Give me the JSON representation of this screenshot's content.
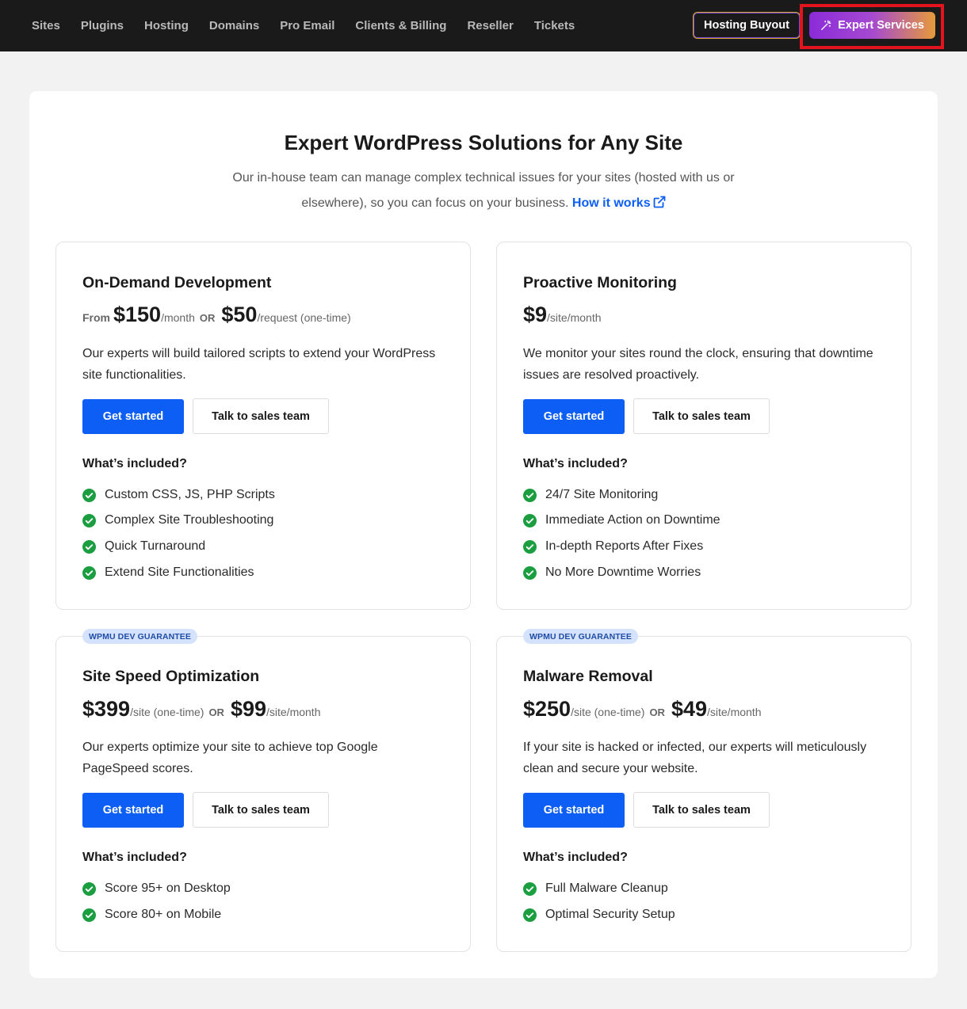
{
  "nav": {
    "items": [
      {
        "label": "Sites",
        "name": "nav-sites"
      },
      {
        "label": "Plugins",
        "name": "nav-plugins"
      },
      {
        "label": "Hosting",
        "name": "nav-hosting"
      },
      {
        "label": "Domains",
        "name": "nav-domains"
      },
      {
        "label": "Pro Email",
        "name": "nav-pro-email"
      },
      {
        "label": "Clients & Billing",
        "name": "nav-clients-billing"
      },
      {
        "label": "Reseller",
        "name": "nav-reseller"
      },
      {
        "label": "Tickets",
        "name": "nav-tickets"
      }
    ],
    "hosting_buyout": "Hosting Buyout",
    "expert_services": "Expert Services",
    "expert_icon": "magic-wand-icon"
  },
  "header": {
    "title": "Expert WordPress Solutions for Any Site",
    "subtitle": "Our in-house team can manage complex technical issues for your sites (hosted with us or elsewhere), so you can focus on your business.",
    "link": "How it works",
    "link_icon": "external-link-icon"
  },
  "colors": {
    "primary": "#0d5ef5",
    "check": "#1a9e3f",
    "highlight": "#e3141e",
    "badge_bg": "#d5e2fb"
  },
  "cards": {
    "dev": {
      "title": "On-Demand Development",
      "price": {
        "from": "From",
        "p1": "$150",
        "u1": "/month",
        "or": "OR",
        "p2": "$50",
        "u2": "/request (one-time)"
      },
      "desc": "Our experts will build tailored scripts to extend your WordPress site functionalities.",
      "get_started": "Get started",
      "talk": "Talk to sales team",
      "included": "What’s included?",
      "features": [
        "Custom CSS, JS, PHP Scripts",
        "Complex Site Troubleshooting",
        "Quick Turnaround",
        "Extend Site Functionalities"
      ]
    },
    "monitor": {
      "title": "Proactive Monitoring",
      "price": {
        "p1": "$9",
        "u1": "/site/month"
      },
      "desc": "We monitor your sites round the clock, ensuring that downtime issues are resolved proactively.",
      "get_started": "Get started",
      "talk": "Talk to sales team",
      "included": "What’s included?",
      "features": [
        "24/7 Site Monitoring",
        "Immediate Action on Downtime",
        "In-depth Reports After Fixes",
        "No More Downtime Worries"
      ]
    },
    "speed": {
      "badge": "WPMU DEV GUARANTEE",
      "title": "Site Speed Optimization",
      "price": {
        "p1": "$399",
        "u1": "/site (one-time)",
        "or": "OR",
        "p2": "$99",
        "u2": "/site/month"
      },
      "desc": "Our experts optimize your site to achieve top Google PageSpeed scores.",
      "get_started": "Get started",
      "talk": "Talk to sales team",
      "included": "What’s included?",
      "features": [
        "Score 95+ on Desktop",
        "Score 80+ on Mobile"
      ]
    },
    "malware": {
      "badge": "WPMU DEV GUARANTEE",
      "title": "Malware Removal",
      "price": {
        "p1": "$250",
        "u1": "/site (one-time)",
        "or": "OR",
        "p2": "$49",
        "u2": "/site/month"
      },
      "desc": "If your site is hacked or infected, our experts will meticulously clean and secure your website.",
      "get_started": "Get started",
      "talk": "Talk to sales team",
      "included": "What’s included?",
      "features": [
        "Full Malware Cleanup",
        "Optimal Security Setup"
      ]
    }
  }
}
